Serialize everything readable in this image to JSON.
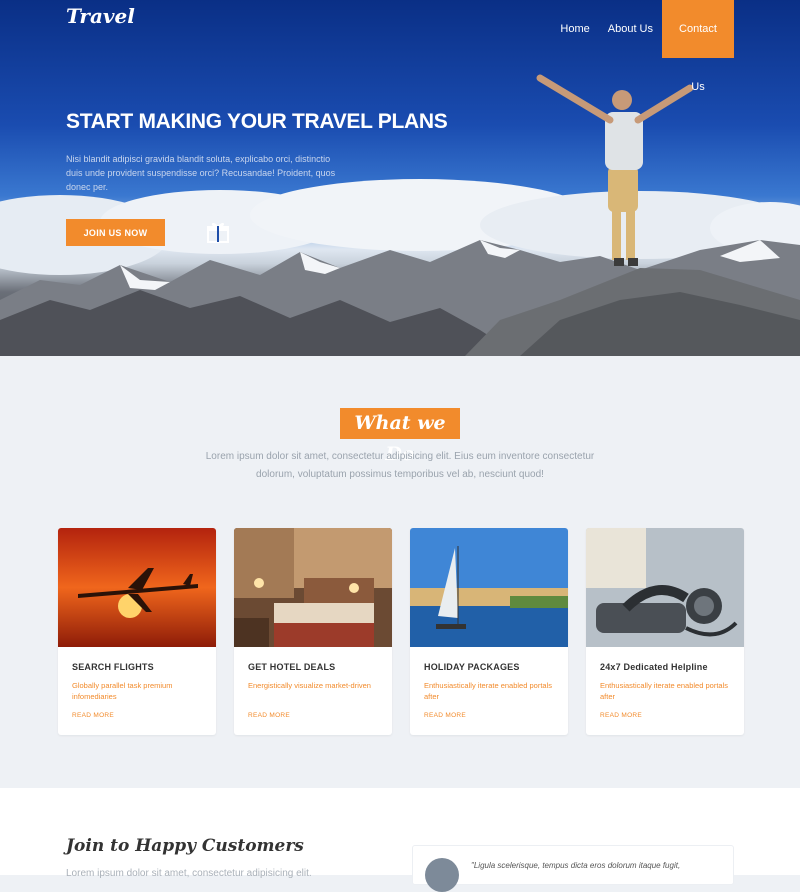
{
  "nav": {
    "brand": "Travel",
    "links": [
      {
        "label": "Home"
      },
      {
        "label": "About Us"
      },
      {
        "label": "Contact Us"
      }
    ]
  },
  "hero": {
    "title": "START MAKING YOUR TRAVEL PLANS",
    "text": "Nisi blandit adipisci gravida blandit soluta, explicabo orci, distinctio duis unde provident suspendisse orci? Recusandae! Proident, quos donec per.",
    "cta_label": "JOIN US NOW"
  },
  "services": {
    "title": "What we Do",
    "subtitle": "Lorem ipsum dolor sit amet, consectetur adipisicing elit. Eius eum inventore consectetur dolorum, voluptatum possimus temporibus vel ab, nesciunt quod!",
    "cards": [
      {
        "title": "SEARCH FLIGHTS",
        "text": "Globally parallel task premium infomediaries",
        "link": "READ MORE"
      },
      {
        "title": "GET HOTEL DEALS",
        "text": "Energistically visualize market-driven",
        "link": "READ MORE"
      },
      {
        "title": "HOLIDAY PACKAGES",
        "text": "Enthusiastically iterate enabled portals after",
        "link": "READ MORE"
      },
      {
        "title": "24x7 Dedicated Helpline",
        "text": "Enthusiastically iterate enabled portals after",
        "link": "READ MORE"
      }
    ]
  },
  "testimonials": {
    "title": "Join to Happy Customers",
    "text": "Lorem ipsum dolor sit amet, consectetur adipisicing elit.",
    "quote": "\"Ligula scelerisque, tempus dicta eros dolorum itaque fugit,"
  },
  "colors": {
    "accent": "#f28b2c",
    "hero_sky": "#0a2f86",
    "page_bg": "#eef1f5"
  }
}
